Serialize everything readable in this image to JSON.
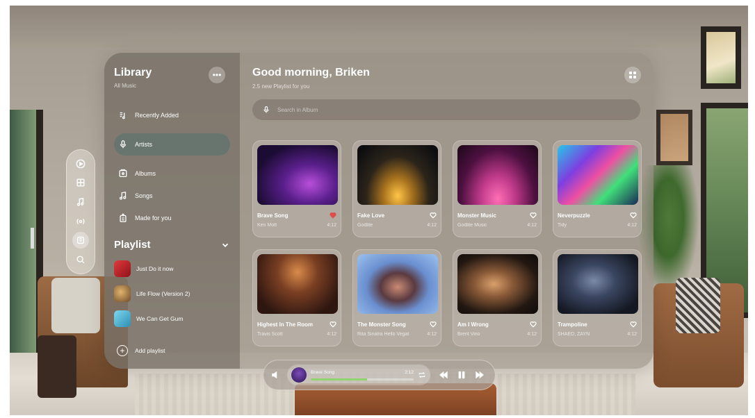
{
  "sidebar": {
    "title": "Library",
    "subtitle": "All Music",
    "items": [
      {
        "label": "Recently Added",
        "icon": "recently-added-icon"
      },
      {
        "label": "Artists",
        "icon": "microphone-icon",
        "active": true
      },
      {
        "label": "Albums",
        "icon": "album-icon"
      },
      {
        "label": "Songs",
        "icon": "music-note-icon"
      },
      {
        "label": "Made for you",
        "icon": "made-for-you-icon"
      }
    ],
    "playlist_title": "Playlist",
    "playlists": [
      {
        "label": "Just Do it now",
        "color": "#c9232a"
      },
      {
        "label": "Life Flow (Version 2)",
        "color": "#a07a4a"
      },
      {
        "label": "We Can Get Gum",
        "color": "#4fb6d6"
      }
    ],
    "add_playlist_label": "Add playlist"
  },
  "header": {
    "greeting": "Good morning, Briken",
    "subtitle": "2.5 new Playlist for you"
  },
  "search": {
    "placeholder": "Search in Album"
  },
  "cards": [
    {
      "title": "Brave Song",
      "artist": "Ken Mott",
      "duration": "4:12",
      "liked": true
    },
    {
      "title": "Fake Love",
      "artist": "Godlite",
      "duration": "4:12",
      "liked": false
    },
    {
      "title": "Monster Music",
      "artist": "Godlite Music",
      "duration": "4:12",
      "liked": false
    },
    {
      "title": "Neverpuzzle",
      "artist": "Tidy",
      "duration": "4:12",
      "liked": false
    },
    {
      "title": "Highest In The Room",
      "artist": "Travis Scott",
      "duration": "4:12",
      "liked": false
    },
    {
      "title": "The Monster Song",
      "artist": "Rita Sinatra Hello Vegat",
      "duration": "4:12",
      "liked": false
    },
    {
      "title": "Am I Wrong",
      "artist": "Brent Vino",
      "duration": "4:12",
      "liked": false
    },
    {
      "title": "Trampoline",
      "artist": "SHAED, ZAYN",
      "duration": "4:12",
      "liked": false
    }
  ],
  "player": {
    "now_playing": "Brave Song",
    "time": "2:12",
    "progress": 0.55
  },
  "colors": {
    "accent_progress": "#8fd46e",
    "like_red": "#e04b4b",
    "active_item": "#5a736e"
  }
}
